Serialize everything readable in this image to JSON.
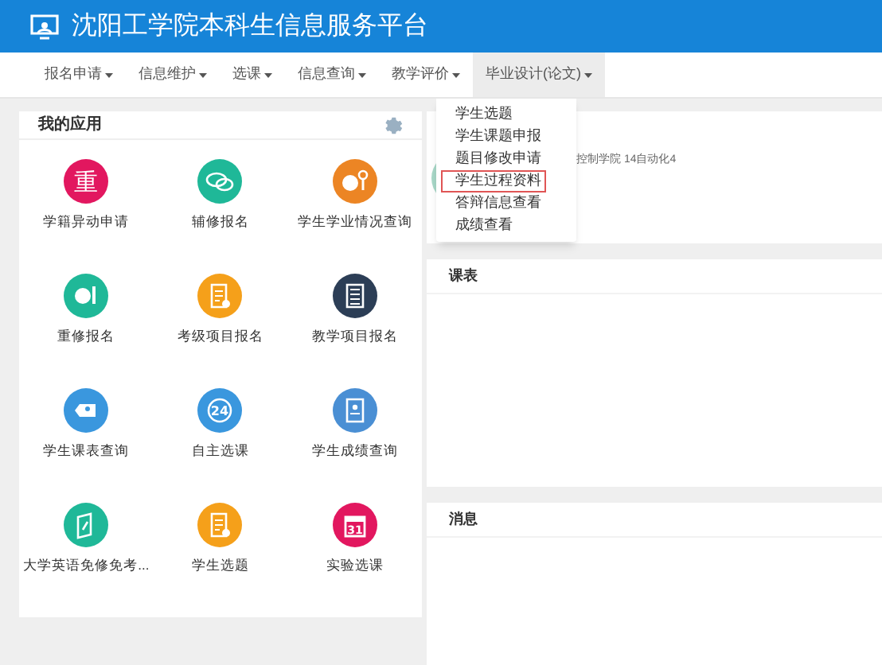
{
  "header": {
    "title": "沈阳工学院本科生信息服务平台"
  },
  "nav": [
    {
      "label": "报名申请",
      "selected": false
    },
    {
      "label": "信息维护",
      "selected": false
    },
    {
      "label": "选课",
      "selected": false
    },
    {
      "label": "信息查询",
      "selected": false
    },
    {
      "label": "教学评价",
      "selected": false
    },
    {
      "label": "毕业设计(论文)",
      "selected": true
    }
  ],
  "dropdown": [
    {
      "label": "学生选题",
      "selected": false
    },
    {
      "label": "学生课题申报",
      "selected": false
    },
    {
      "label": "题目修改申请",
      "selected": false
    },
    {
      "label": "学生过程资料",
      "selected": true
    },
    {
      "label": "答辩信息查看",
      "selected": false
    },
    {
      "label": "成绩查看",
      "selected": false
    }
  ],
  "apps_panel": {
    "title": "我的应用",
    "apps": [
      {
        "label": "学籍异动申请",
        "glyph": "重",
        "color": "#e2175f"
      },
      {
        "label": "辅修报名",
        "color": "#1fb898"
      },
      {
        "label": "学生学业情况查询",
        "color": "#ec8524"
      },
      {
        "label": "重修报名",
        "color": "#1fb898"
      },
      {
        "label": "考级项目报名",
        "color": "#f5a01a"
      },
      {
        "label": "教学项目报名",
        "color": "#2c3e56"
      },
      {
        "label": "学生课表查询",
        "color": "#3a97de"
      },
      {
        "label": "自主选课",
        "glyph": "24",
        "color": "#3a97de"
      },
      {
        "label": "学生成绩查询",
        "color": "#4a8fd4"
      },
      {
        "label": "大学英语免修免考...",
        "color": "#1fb898"
      },
      {
        "label": "学生选题",
        "color": "#f5a01a"
      },
      {
        "label": "实验选课",
        "glyph": "31",
        "color": "#e2175f"
      }
    ]
  },
  "profile": {
    "info": "控制学院 14自动化4"
  },
  "schedule": {
    "title": "课表"
  },
  "messages": {
    "title": "消息"
  }
}
